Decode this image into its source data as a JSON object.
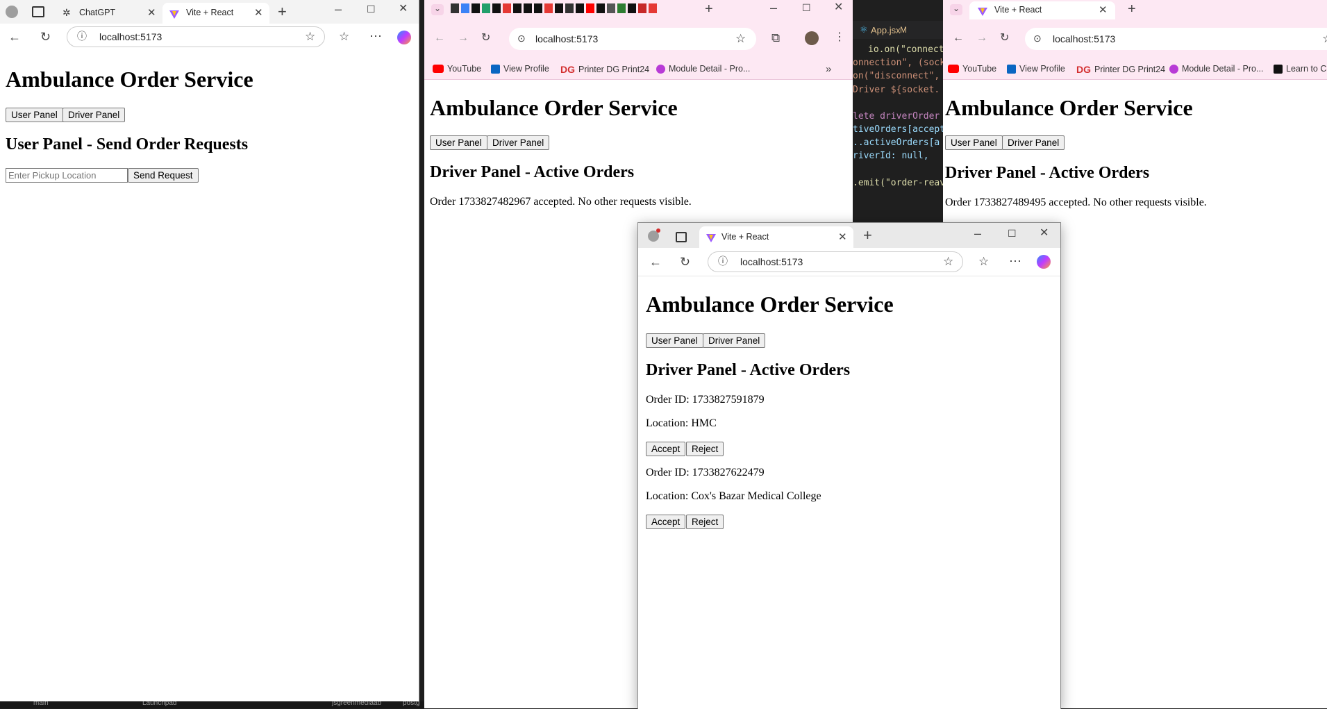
{
  "app": {
    "heading": "Ambulance Order Service",
    "user_panel_btn": "User Panel",
    "driver_panel_btn": "Driver Panel",
    "user_panel_title": "User Panel - Send Order Requests",
    "pickup_placeholder": "Enter Pickup Location",
    "send_request_btn": "Send Request",
    "driver_panel_title": "Driver Panel - Active Orders",
    "accept_btn": "Accept",
    "reject_btn": "Reject"
  },
  "win1": {
    "tab_chatgpt": "ChatGPT",
    "tab_vite": "Vite + React",
    "url": "localhost:5173"
  },
  "win2": {
    "url": "localhost:5173",
    "bookmarks": [
      "YouTube",
      "View Profile",
      "Printer DG Print24",
      "Module Detail - Pro..."
    ],
    "accepted_msg": "Order 1733827482967 accepted. No other requests visible."
  },
  "editor": {
    "file_tab": "App.jsx",
    "file_status": "M",
    "lines": [
      "io.on(\"connection",
      "onnection\", (sock",
      "on(\"disconnect\",",
      "Driver ${socket.",
      "",
      "lete driverOrder",
      "tiveOrders[accept",
      "..activeOrders[a",
      "riverId: null,",
      "",
      ".emit(\"order-reav"
    ]
  },
  "win3": {
    "tab_vite": "Vite + React",
    "url": "localhost:5173",
    "bookmarks": [
      "YouTube",
      "View Profile",
      "Printer DG Print24",
      "Module Detail - Pro...",
      "Learn to C"
    ],
    "accepted_msg": "Order 1733827489495 accepted. No other requests visible."
  },
  "win4": {
    "tab_vite": "Vite + React",
    "url": "localhost:5173",
    "orders": [
      {
        "id_label": "Order ID: 1733827591879",
        "location_label": "Location: HMC"
      },
      {
        "id_label": "Order ID: 1733827622479",
        "location_label": "Location: Cox's Bazar Medical College"
      }
    ]
  },
  "taskbar": {
    "items": [
      "main",
      "Launchpad",
      "jsgreenmediaab",
      "postg"
    ]
  },
  "colors": {
    "edge_titlebar": "#f3f3f3",
    "chrome_pink": "#fde8f3",
    "editor_bg": "#1f1f1f",
    "youtube_red": "#ff0000",
    "linkedin_blue": "#0a66c2",
    "dg_red": "#d32f2f"
  }
}
